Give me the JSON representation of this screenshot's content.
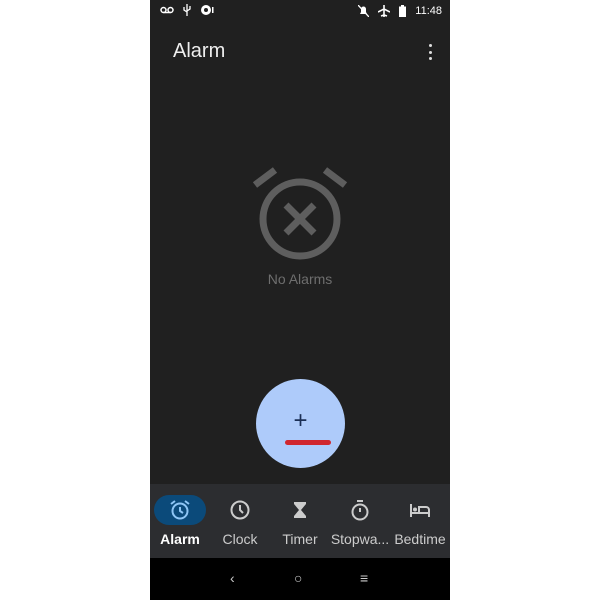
{
  "status_bar": {
    "time": "11:48",
    "left_icons": [
      "voicemail-icon",
      "usb-icon",
      "sync-icon"
    ],
    "right_icons": [
      "notifications-off-icon",
      "airplane-icon",
      "battery-icon"
    ]
  },
  "header": {
    "title": "Alarm",
    "menu_icon": "more-vert-icon"
  },
  "empty_state": {
    "icon": "alarm-off-icon",
    "text": "No Alarms"
  },
  "fab": {
    "label": "+",
    "icon": "add-icon"
  },
  "bottom_nav": {
    "items": [
      {
        "label": "Alarm",
        "icon": "alarm-icon",
        "active": true
      },
      {
        "label": "Clock",
        "icon": "clock-icon",
        "active": false
      },
      {
        "label": "Timer",
        "icon": "hourglass-icon",
        "active": false
      },
      {
        "label": "Stopwa...",
        "icon": "stopwatch-icon",
        "active": false
      },
      {
        "label": "Bedtime",
        "icon": "bed-icon",
        "active": false
      }
    ]
  },
  "system_nav": {
    "back": "‹",
    "home": "○",
    "recents": "≡"
  },
  "colors": {
    "background": "#202020",
    "fab": "#aecbfa",
    "active_pill": "#0b4a7a",
    "accent_underline": "#d0262e"
  }
}
